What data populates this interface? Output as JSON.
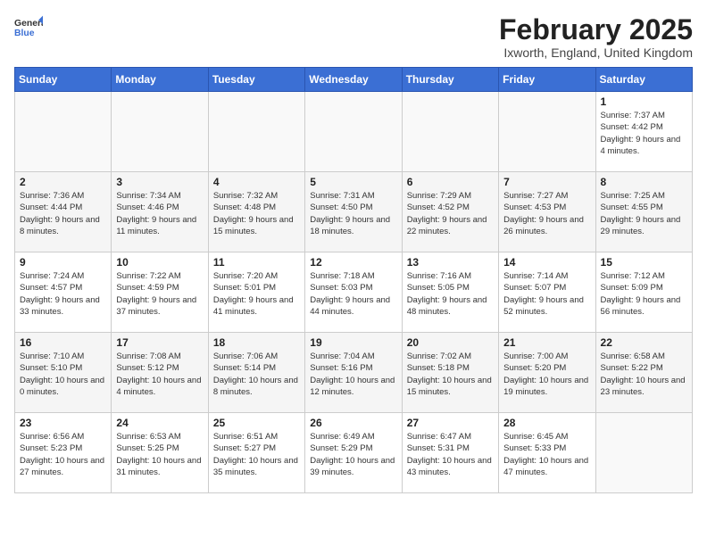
{
  "header": {
    "logo_general": "General",
    "logo_blue": "Blue",
    "month_title": "February 2025",
    "location": "Ixworth, England, United Kingdom"
  },
  "days_of_week": [
    "Sunday",
    "Monday",
    "Tuesday",
    "Wednesday",
    "Thursday",
    "Friday",
    "Saturday"
  ],
  "weeks": [
    [
      {
        "day": "",
        "info": ""
      },
      {
        "day": "",
        "info": ""
      },
      {
        "day": "",
        "info": ""
      },
      {
        "day": "",
        "info": ""
      },
      {
        "day": "",
        "info": ""
      },
      {
        "day": "",
        "info": ""
      },
      {
        "day": "1",
        "info": "Sunrise: 7:37 AM\nSunset: 4:42 PM\nDaylight: 9 hours and 4 minutes."
      }
    ],
    [
      {
        "day": "2",
        "info": "Sunrise: 7:36 AM\nSunset: 4:44 PM\nDaylight: 9 hours and 8 minutes."
      },
      {
        "day": "3",
        "info": "Sunrise: 7:34 AM\nSunset: 4:46 PM\nDaylight: 9 hours and 11 minutes."
      },
      {
        "day": "4",
        "info": "Sunrise: 7:32 AM\nSunset: 4:48 PM\nDaylight: 9 hours and 15 minutes."
      },
      {
        "day": "5",
        "info": "Sunrise: 7:31 AM\nSunset: 4:50 PM\nDaylight: 9 hours and 18 minutes."
      },
      {
        "day": "6",
        "info": "Sunrise: 7:29 AM\nSunset: 4:52 PM\nDaylight: 9 hours and 22 minutes."
      },
      {
        "day": "7",
        "info": "Sunrise: 7:27 AM\nSunset: 4:53 PM\nDaylight: 9 hours and 26 minutes."
      },
      {
        "day": "8",
        "info": "Sunrise: 7:25 AM\nSunset: 4:55 PM\nDaylight: 9 hours and 29 minutes."
      }
    ],
    [
      {
        "day": "9",
        "info": "Sunrise: 7:24 AM\nSunset: 4:57 PM\nDaylight: 9 hours and 33 minutes."
      },
      {
        "day": "10",
        "info": "Sunrise: 7:22 AM\nSunset: 4:59 PM\nDaylight: 9 hours and 37 minutes."
      },
      {
        "day": "11",
        "info": "Sunrise: 7:20 AM\nSunset: 5:01 PM\nDaylight: 9 hours and 41 minutes."
      },
      {
        "day": "12",
        "info": "Sunrise: 7:18 AM\nSunset: 5:03 PM\nDaylight: 9 hours and 44 minutes."
      },
      {
        "day": "13",
        "info": "Sunrise: 7:16 AM\nSunset: 5:05 PM\nDaylight: 9 hours and 48 minutes."
      },
      {
        "day": "14",
        "info": "Sunrise: 7:14 AM\nSunset: 5:07 PM\nDaylight: 9 hours and 52 minutes."
      },
      {
        "day": "15",
        "info": "Sunrise: 7:12 AM\nSunset: 5:09 PM\nDaylight: 9 hours and 56 minutes."
      }
    ],
    [
      {
        "day": "16",
        "info": "Sunrise: 7:10 AM\nSunset: 5:10 PM\nDaylight: 10 hours and 0 minutes."
      },
      {
        "day": "17",
        "info": "Sunrise: 7:08 AM\nSunset: 5:12 PM\nDaylight: 10 hours and 4 minutes."
      },
      {
        "day": "18",
        "info": "Sunrise: 7:06 AM\nSunset: 5:14 PM\nDaylight: 10 hours and 8 minutes."
      },
      {
        "day": "19",
        "info": "Sunrise: 7:04 AM\nSunset: 5:16 PM\nDaylight: 10 hours and 12 minutes."
      },
      {
        "day": "20",
        "info": "Sunrise: 7:02 AM\nSunset: 5:18 PM\nDaylight: 10 hours and 15 minutes."
      },
      {
        "day": "21",
        "info": "Sunrise: 7:00 AM\nSunset: 5:20 PM\nDaylight: 10 hours and 19 minutes."
      },
      {
        "day": "22",
        "info": "Sunrise: 6:58 AM\nSunset: 5:22 PM\nDaylight: 10 hours and 23 minutes."
      }
    ],
    [
      {
        "day": "23",
        "info": "Sunrise: 6:56 AM\nSunset: 5:23 PM\nDaylight: 10 hours and 27 minutes."
      },
      {
        "day": "24",
        "info": "Sunrise: 6:53 AM\nSunset: 5:25 PM\nDaylight: 10 hours and 31 minutes."
      },
      {
        "day": "25",
        "info": "Sunrise: 6:51 AM\nSunset: 5:27 PM\nDaylight: 10 hours and 35 minutes."
      },
      {
        "day": "26",
        "info": "Sunrise: 6:49 AM\nSunset: 5:29 PM\nDaylight: 10 hours and 39 minutes."
      },
      {
        "day": "27",
        "info": "Sunrise: 6:47 AM\nSunset: 5:31 PM\nDaylight: 10 hours and 43 minutes."
      },
      {
        "day": "28",
        "info": "Sunrise: 6:45 AM\nSunset: 5:33 PM\nDaylight: 10 hours and 47 minutes."
      },
      {
        "day": "",
        "info": ""
      }
    ]
  ]
}
